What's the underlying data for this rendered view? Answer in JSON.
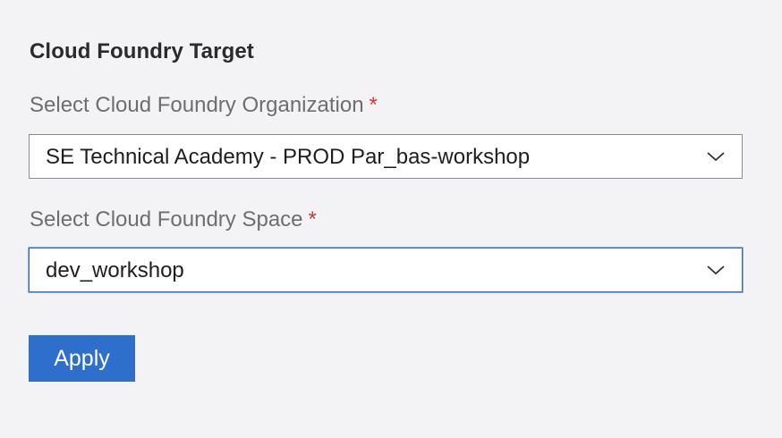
{
  "section": {
    "title": "Cloud Foundry Target"
  },
  "organization": {
    "label": "Select Cloud Foundry Organization",
    "required_mark": "*",
    "selected": "SE Technical Academy - PROD Par_bas-workshop"
  },
  "space": {
    "label": "Select Cloud Foundry Space",
    "required_mark": "*",
    "selected": "dev_workshop"
  },
  "actions": {
    "apply_label": "Apply"
  },
  "icons": {
    "dropdown": "chevron-down-icon"
  },
  "colors": {
    "background": "#f3f3f6",
    "accent": "#2f6fcc",
    "required": "#d7372f",
    "focus_border": "#2c6ac7"
  }
}
